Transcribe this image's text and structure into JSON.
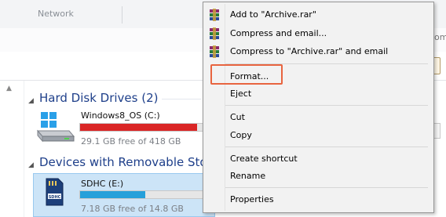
{
  "ribbon": {
    "network_label": "Network",
    "fragment_text": "omp"
  },
  "groups": {
    "hard_disk_header": "Hard Disk Drives (2)",
    "removable_header": "Devices with Removable Stora"
  },
  "drives": {
    "c": {
      "name": "Windows8_OS (C:)",
      "free_text": "29.1 GB free of 418 GB",
      "used_fraction": 0.93,
      "bar_color": "#da2626"
    },
    "e": {
      "name": "SDHC (E:)",
      "free_text": "7.18 GB free of 14.8 GB",
      "used_fraction": 0.52,
      "bar_color": "#26a0da"
    }
  },
  "context_menu": {
    "items": [
      {
        "label": "Add to \"Archive.rar\"",
        "icon": "winrar-icon"
      },
      {
        "label": "Compress and email...",
        "icon": "winrar-icon"
      },
      {
        "label": "Compress to \"Archive.rar\" and email",
        "icon": "winrar-icon"
      },
      {
        "label": "Format..."
      },
      {
        "label": "Eject"
      },
      {
        "label": "Cut"
      },
      {
        "label": "Copy"
      },
      {
        "label": "Create shortcut"
      },
      {
        "label": "Rename"
      },
      {
        "label": "Properties"
      }
    ],
    "highlight_color": "#e8643f"
  }
}
